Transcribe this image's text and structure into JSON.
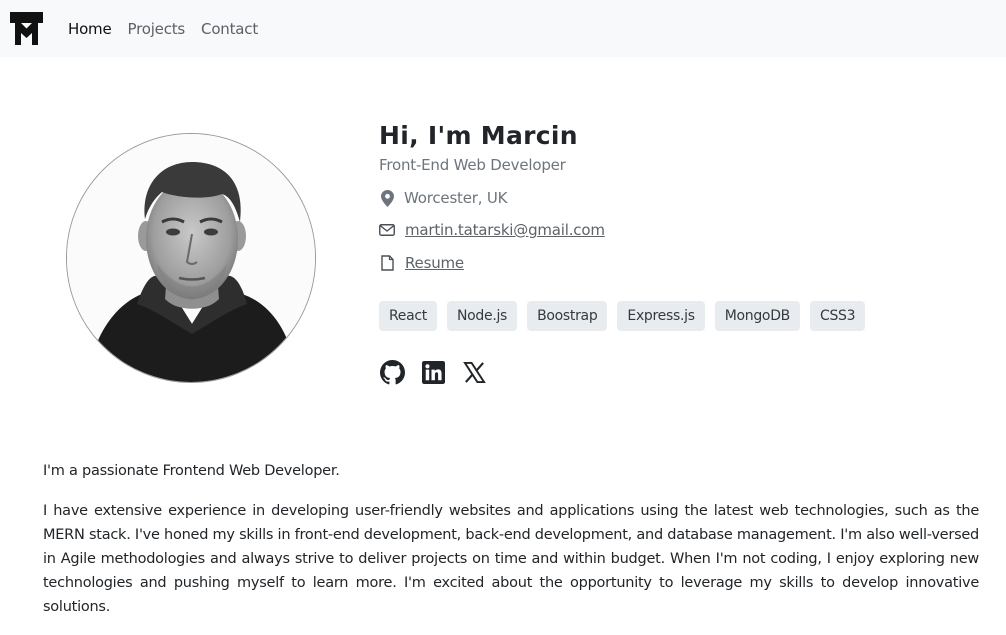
{
  "nav": {
    "links": [
      {
        "label": "Home",
        "active": true
      },
      {
        "label": "Projects",
        "active": false
      },
      {
        "label": "Contact",
        "active": false
      }
    ]
  },
  "profile": {
    "greeting": "Hi, I'm Marcin",
    "role": "Front-End Web Developer",
    "location": "Worcester, UK",
    "email": "martin.tatarski@gmail.com",
    "resume": "Resume"
  },
  "skills": [
    "React",
    "Node.js",
    "Boostrap",
    "Express.js",
    "MongoDB",
    "CSS3"
  ],
  "socials": [
    "github-icon",
    "linkedin-icon",
    "x-icon"
  ],
  "about": {
    "intro": "I'm a passionate Frontend Web Developer.",
    "body": "I have extensive experience in developing user-friendly websites and applications using the latest web technologies, such as the MERN stack. I've honed my skills in front-end development, back-end development, and database management. I'm also well-versed in Agile methodologies and always strive to deliver projects on time and within budget. When I'm not coding, I enjoy exploring new technologies and pushing myself to learn more. I'm excited about the opportunity to leverage my skills to develop innovative solutions."
  },
  "colors": {
    "navbar_bg": "#f8f9fa",
    "badge_bg": "#e9ecef",
    "muted_text": "#6c757d"
  }
}
